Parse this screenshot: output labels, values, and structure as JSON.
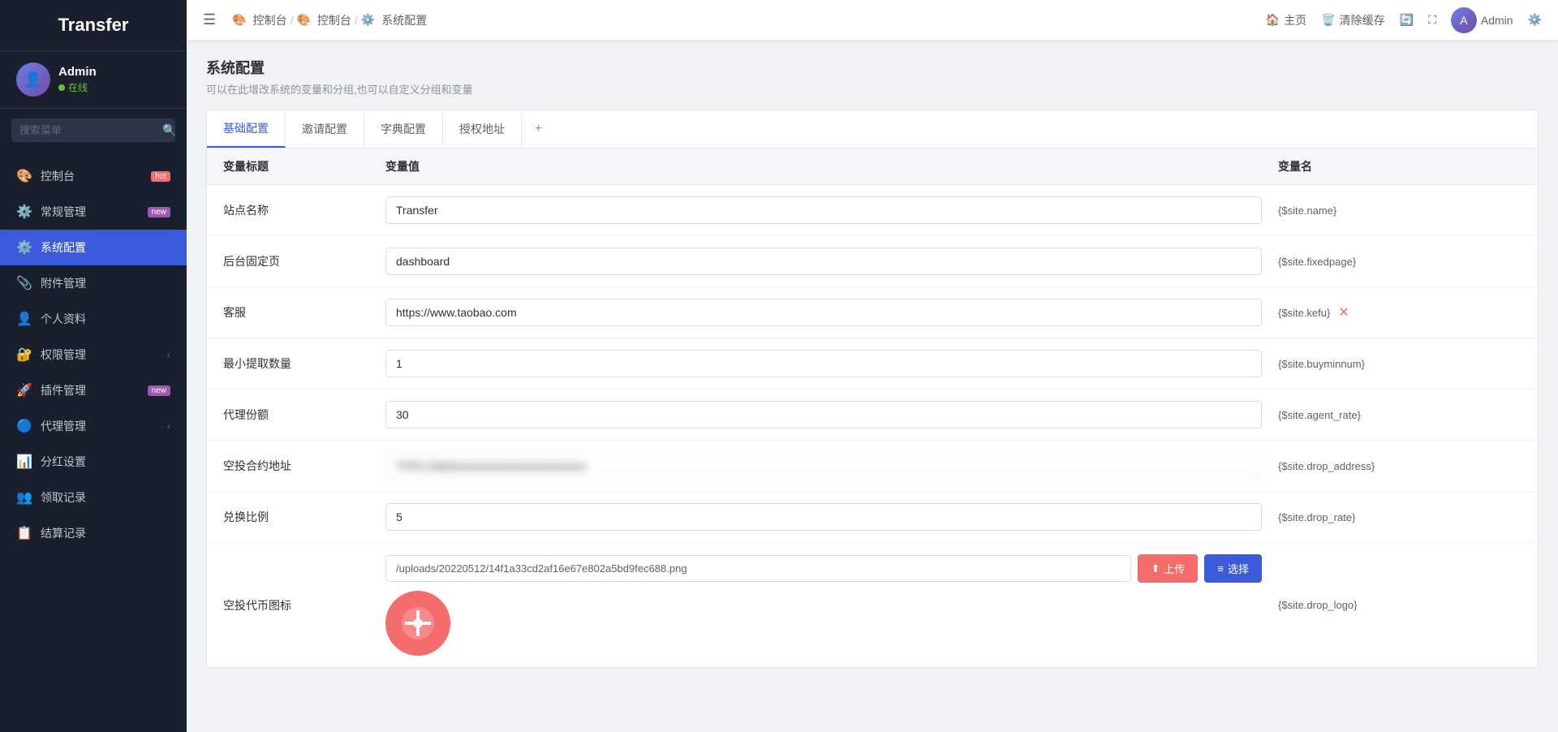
{
  "app": {
    "title": "Transfer"
  },
  "sidebar": {
    "logo": "Transfer",
    "user": {
      "name": "Admin",
      "status": "在线",
      "avatar_letter": "A"
    },
    "search_placeholder": "搜索菜单",
    "nav_items": [
      {
        "id": "dashboard",
        "icon": "🎨",
        "label": "控制台",
        "badge": "hot",
        "badge_text": "hot",
        "has_chevron": false
      },
      {
        "id": "general",
        "icon": "⚙️",
        "label": "常规管理",
        "badge": "new",
        "badge_text": "new",
        "has_chevron": false
      },
      {
        "id": "system",
        "icon": "⚙️",
        "label": "系统配置",
        "badge": "",
        "badge_text": "",
        "has_chevron": false,
        "active": true
      },
      {
        "id": "attachments",
        "icon": "📎",
        "label": "附件管理",
        "badge": "",
        "badge_text": "",
        "has_chevron": false
      },
      {
        "id": "profile",
        "icon": "👤",
        "label": "个人资料",
        "badge": "",
        "badge_text": "",
        "has_chevron": false
      },
      {
        "id": "permissions",
        "icon": "🔐",
        "label": "权限管理",
        "badge": "",
        "badge_text": "",
        "has_chevron": true
      },
      {
        "id": "plugins",
        "icon": "🚀",
        "label": "插件管理",
        "badge": "new",
        "badge_text": "new",
        "has_chevron": false
      },
      {
        "id": "agents",
        "icon": "🔵",
        "label": "代理管理",
        "badge": "",
        "badge_text": "",
        "has_chevron": true
      },
      {
        "id": "dividends",
        "icon": "📊",
        "label": "分红设置",
        "badge": "",
        "badge_text": "",
        "has_chevron": false
      },
      {
        "id": "claim",
        "icon": "👥",
        "label": "领取记录",
        "badge": "",
        "badge_text": "",
        "has_chevron": false
      },
      {
        "id": "settlement",
        "icon": "📋",
        "label": "结算记录",
        "badge": "",
        "badge_text": "",
        "has_chevron": false
      }
    ]
  },
  "topbar": {
    "hamburger_label": "☰",
    "breadcrumbs": [
      {
        "icon": "🎨",
        "label": "控制台"
      },
      {
        "icon": "🎨",
        "label": "控制台"
      },
      {
        "icon": "⚙️",
        "label": "系统配置"
      }
    ],
    "right_items": [
      {
        "id": "home",
        "icon": "🏠",
        "label": "主页"
      },
      {
        "id": "clear-cache",
        "icon": "🗑️",
        "label": "清除缓存"
      },
      {
        "id": "refresh",
        "icon": "🔄",
        "label": ""
      },
      {
        "id": "fullscreen",
        "icon": "⛶",
        "label": ""
      }
    ],
    "admin_label": "Admin",
    "admin_icon": "⚙️"
  },
  "page": {
    "title": "系统配置",
    "subtitle": "可以在此增改系统的变量和分组,也可以自定义分组和变量"
  },
  "tabs": [
    {
      "id": "basic",
      "label": "基础配置",
      "active": true
    },
    {
      "id": "invite",
      "label": "邀请配置",
      "active": false
    },
    {
      "id": "dict",
      "label": "字典配置",
      "active": false
    },
    {
      "id": "auth",
      "label": "授权地址",
      "active": false
    },
    {
      "id": "add",
      "label": "+",
      "active": false
    }
  ],
  "table": {
    "col_label": "变量标题",
    "col_value": "变量值",
    "col_varname": "变量名",
    "rows": [
      {
        "id": "site_name",
        "label": "站点名称",
        "value": "Transfer",
        "varname": "{$site.name}",
        "has_del": false,
        "type": "text"
      },
      {
        "id": "fixed_page",
        "label": "后台固定页",
        "value": "dashboard",
        "varname": "{$site.fixedpage}",
        "has_del": false,
        "type": "text"
      },
      {
        "id": "kefu",
        "label": "客服",
        "value": "https://www.taobao.com",
        "varname": "{$site.kefu}",
        "has_del": true,
        "type": "text"
      },
      {
        "id": "buyminnum",
        "label": "最小提取数量",
        "value": "1",
        "varname": "{$site.buyminnum}",
        "has_del": false,
        "type": "text"
      },
      {
        "id": "agent_rate",
        "label": "代理份额",
        "value": "30",
        "varname": "{$site.agent_rate}",
        "has_del": false,
        "type": "text"
      },
      {
        "id": "drop_address",
        "label": "空投合约地址",
        "value": "TCFLL5dx5",
        "varname": "{$site.drop_address}",
        "has_del": false,
        "type": "text_blurred"
      },
      {
        "id": "drop_rate",
        "label": "兑换比例",
        "value": "5",
        "varname": "{$site.drop_rate}",
        "has_del": false,
        "type": "text"
      },
      {
        "id": "drop_logo",
        "label": "空投代币图标",
        "value": "/uploads/20220512/14f1a33cd2af16e67e802a5bd9fec688.png",
        "varname": "{$site.drop_logo}",
        "has_del": false,
        "type": "file"
      }
    ],
    "upload_label": "上传",
    "select_label": "选择",
    "upload_icon": "⬆",
    "select_icon": "≡",
    "image_preview_icon": "÷"
  }
}
